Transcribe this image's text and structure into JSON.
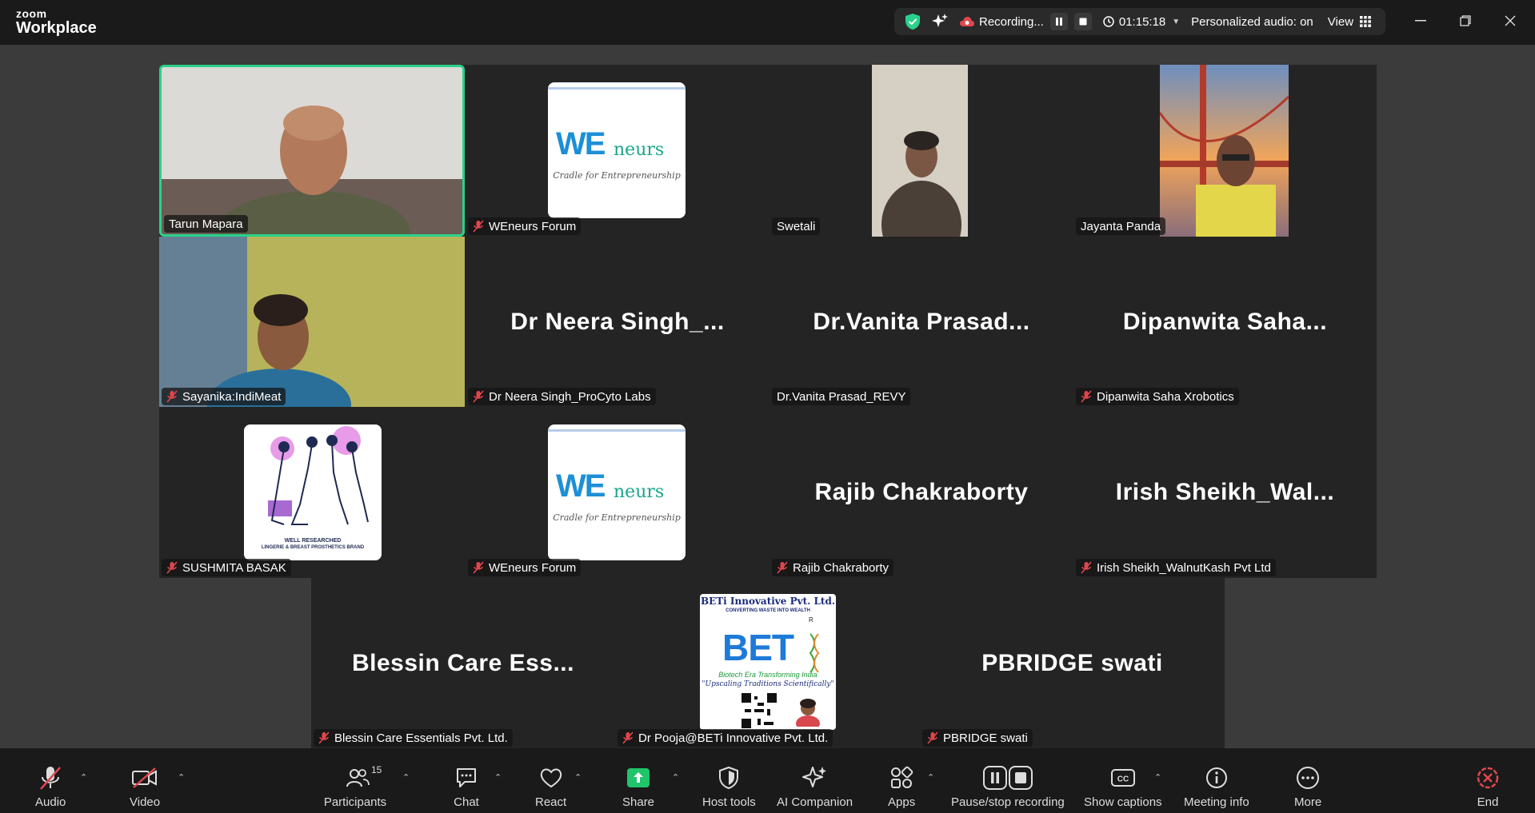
{
  "app": {
    "brand_top": "zoom",
    "brand_bottom": "Workplace"
  },
  "status_bar": {
    "recording_label": "Recording...",
    "timer": "01:15:18",
    "personalized_audio": "Personalized audio: on",
    "view_label": "View"
  },
  "tiles": [
    {
      "name": "Tarun Mapara",
      "muted": false,
      "kind": "video"
    },
    {
      "name": "WEneurs Forum",
      "muted": true,
      "kind": "logo-weneurs"
    },
    {
      "name": "Swetali",
      "muted": false,
      "kind": "video"
    },
    {
      "name": "Jayanta Panda",
      "muted": false,
      "kind": "video"
    },
    {
      "name": "Sayanika:IndiMeat",
      "muted": true,
      "kind": "video"
    },
    {
      "name": "Dr Neera Singh_ProCyto Labs",
      "muted": true,
      "kind": "text",
      "display": "Dr  Neera Singh_..."
    },
    {
      "name": "Dr.Vanita Prasad_REVY",
      "muted": false,
      "kind": "text",
      "display": "Dr.Vanita  Prasad..."
    },
    {
      "name": "Dipanwita Saha Xrobotics",
      "muted": true,
      "kind": "text",
      "display": "Dipanwita  Saha..."
    },
    {
      "name": "SUSHMITA BASAK",
      "muted": true,
      "kind": "logo-brand",
      "logo_caption_1": "WELL RESEARCHED",
      "logo_caption_2": "LINGERIE & BREAST PROSTHETICS BRAND"
    },
    {
      "name": "WEneurs Forum",
      "muted": true,
      "kind": "logo-weneurs"
    },
    {
      "name": "Rajib Chakraborty",
      "muted": true,
      "kind": "text",
      "display": "Rajib  Chakraborty"
    },
    {
      "name": "Irish Sheikh_WalnutKash Pvt Ltd",
      "muted": true,
      "kind": "text",
      "display": "Irish  Sheikh_Wal..."
    },
    {
      "name": "Blessin Care Essentials Pvt. Ltd.",
      "muted": true,
      "kind": "text",
      "display": "Blessin  Care  Ess..."
    },
    {
      "name": "Dr Pooja@BETi Innovative Pvt. Ltd.",
      "muted": true,
      "kind": "logo-beti"
    },
    {
      "name": "PBRIDGE swati",
      "muted": true,
      "kind": "text",
      "display": "PBRIDGE swati"
    }
  ],
  "weneurs_logo": {
    "word_we": "WE",
    "word_neurs": "neurs",
    "tagline": "Cradle for Entrepreneurship"
  },
  "beti_logo": {
    "company": "BETi Innovative Pvt. Ltd.",
    "motto": "CONVERTING WASTE INTO WEALTH",
    "mark": "BET",
    "sub": "Biotech Era Transforming India",
    "quote": "\"Upscaling Traditions Scientifically\"",
    "reg": "R"
  },
  "toolbar": {
    "audio": "Audio",
    "video": "Video",
    "participants": "Participants",
    "participants_count": "15",
    "chat": "Chat",
    "react": "React",
    "share": "Share",
    "host_tools": "Host tools",
    "ai_companion": "AI Companion",
    "apps": "Apps",
    "pause_stop": "Pause/stop recording",
    "captions": "Show captions",
    "meeting_info": "Meeting info",
    "more": "More",
    "end": "End"
  },
  "colors": {
    "active_border": "#2ad18a",
    "share_green": "#1fc46b",
    "mute_red": "#e0464d",
    "end_red": "#e0464d"
  }
}
